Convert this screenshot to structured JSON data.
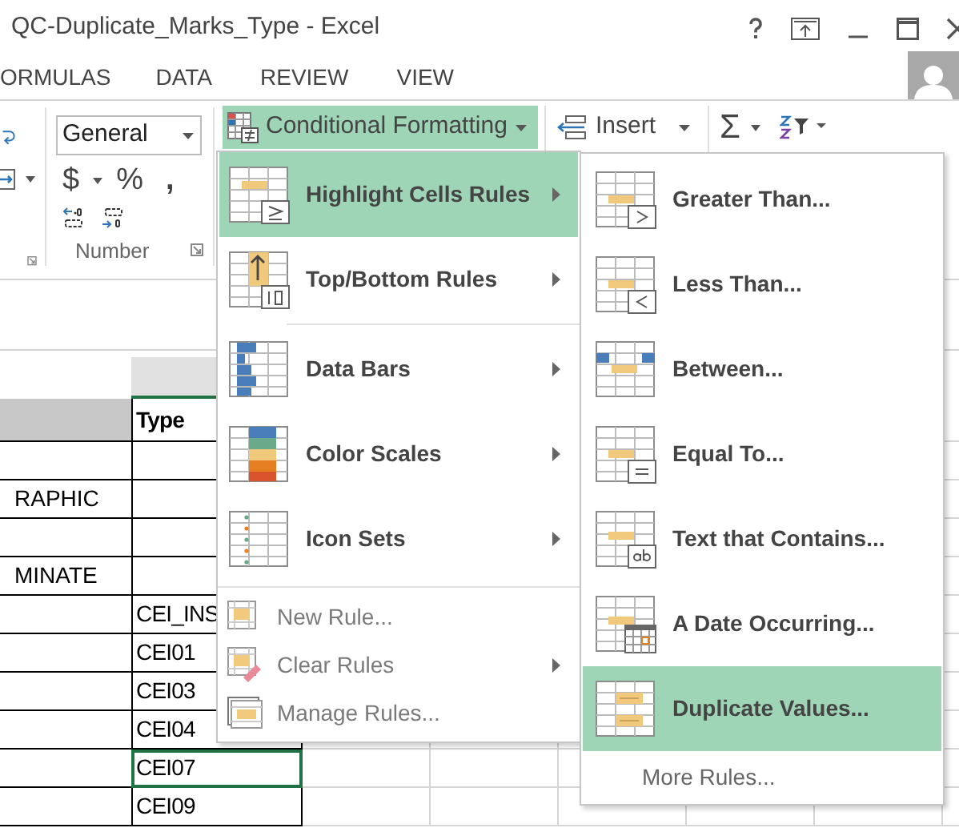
{
  "window": {
    "title": "QC-Duplicate_Marks_Type - Excel"
  },
  "ribbon_tabs": [
    {
      "label": "ORMULAS"
    },
    {
      "label": "DATA"
    },
    {
      "label": "REVIEW"
    },
    {
      "label": "VIEW"
    }
  ],
  "number_group": {
    "format": "General",
    "currency": "$",
    "percent": "%",
    "comma": ",",
    "label": "Number"
  },
  "conditional_formatting": {
    "label": "Conditional Formatting",
    "open": true
  },
  "insert": {
    "label": "Insert"
  },
  "autosum": {
    "symbol": "Σ"
  },
  "sheet": {
    "header": "Type",
    "rows": [
      {
        "selected": false
      },
      {
        "column_a": "RAPHIC",
        "selected": false
      },
      {
        "selected": false
      },
      {
        "column_a": "MINATE",
        "selected": false
      },
      {
        "type": "CEI_INS",
        "selected": false
      },
      {
        "type": "CEI01",
        "selected": false
      },
      {
        "type": "CEI03",
        "selected": false
      },
      {
        "type": "CEI04",
        "selected": false
      },
      {
        "type": "CEI07",
        "selected": true
      },
      {
        "type": "CEI09",
        "selected": false
      }
    ]
  },
  "menu": {
    "items": [
      {
        "label": "Highlight Cells Rules",
        "kind": "highlight",
        "selected": true,
        "submenu": true
      },
      {
        "label": "Top/Bottom Rules",
        "kind": "topbottom",
        "selected": false,
        "submenu": true
      },
      {
        "label": "Data Bars",
        "kind": "databars",
        "selected": false,
        "submenu": true
      },
      {
        "label": "Color Scales",
        "kind": "colorscales",
        "selected": false,
        "submenu": true
      },
      {
        "label": "Icon Sets",
        "kind": "iconsets",
        "selected": false,
        "submenu": true
      },
      {
        "label": "New Rule...",
        "kind": "newrule",
        "selected": false,
        "submenu": false
      },
      {
        "label": "Clear Rules",
        "kind": "clearrules",
        "selected": false,
        "submenu": true
      },
      {
        "label": "Manage Rules...",
        "kind": "managerules",
        "selected": false,
        "submenu": false
      }
    ]
  },
  "submenu": {
    "items": [
      {
        "label": "Greater Than...",
        "kind": "greater",
        "selected": false
      },
      {
        "label": "Less Than...",
        "kind": "less",
        "selected": false
      },
      {
        "label": "Between...",
        "kind": "between",
        "selected": false
      },
      {
        "label": "Equal To...",
        "kind": "equal",
        "selected": false
      },
      {
        "label": "Text that Contains...",
        "kind": "text",
        "selected": false
      },
      {
        "label": "A Date Occurring...",
        "kind": "date",
        "selected": false
      },
      {
        "label": "Duplicate Values...",
        "kind": "duplicate",
        "selected": true
      },
      {
        "label": "More Rules...",
        "kind": "more",
        "selected": false
      }
    ]
  }
}
